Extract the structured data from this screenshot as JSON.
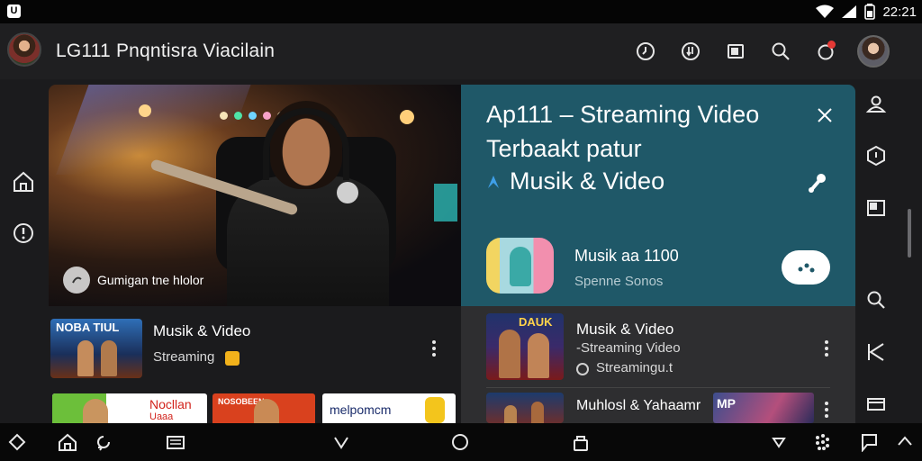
{
  "status_bar": {
    "time": "22:21",
    "icons": [
      "app-badge-icon",
      "wifi-icon",
      "cellular-signal-icon",
      "battery-icon"
    ]
  },
  "header": {
    "title": "LG111 Pnqntisra Viacilain",
    "icons": [
      "clock-icon",
      "download-icon",
      "cast-icon",
      "search-icon",
      "notification-icon",
      "profile-avatar"
    ],
    "accent": "#e53935"
  },
  "left_rail": {
    "items": [
      "home-icon",
      "power-icon"
    ]
  },
  "hero": {
    "caption": "Gumigan tne hlolor"
  },
  "promo": {
    "line1": "Ap111 – Streaming Video",
    "line2": "Terbaakt patur",
    "line3": "Musik & Video",
    "background": "#1f5868",
    "card": {
      "title": "Musik aa 1100",
      "subtitle": "Spenne Sonos"
    }
  },
  "feed": {
    "left_items": [
      {
        "thumb_text": "NOBA TIUL",
        "title": "Musik & Video",
        "subtitle": "Streaming"
      }
    ],
    "right_items": [
      {
        "thumb_text": "DAUK",
        "title": "Musik & Video",
        "subtitle": "-Streaming Video",
        "status": "Streamingu.t"
      },
      {
        "title": "Muhlosl & Yahaamr",
        "badge": "MP"
      }
    ],
    "bottom_cards": [
      {
        "text": "Nocllan",
        "text2": "Uaaa"
      },
      {
        "text": "NOSOBEEN"
      },
      {
        "text": "melpomcm"
      }
    ]
  },
  "right_rail": {
    "items": [
      "contacts-icon",
      "box-icon",
      "window-icon",
      "search-icon",
      "skip-back-icon",
      "cards-icon"
    ]
  },
  "nav_bar": {
    "items": [
      "android-home-icon",
      "home-icon",
      "refresh-icon",
      "recent-apps-icon",
      "back-chevron-icon",
      "circle-home-icon",
      "lock-icon",
      "down-chevron-icon",
      "apps-grid-icon",
      "chat-icon",
      "expand-icon"
    ]
  }
}
